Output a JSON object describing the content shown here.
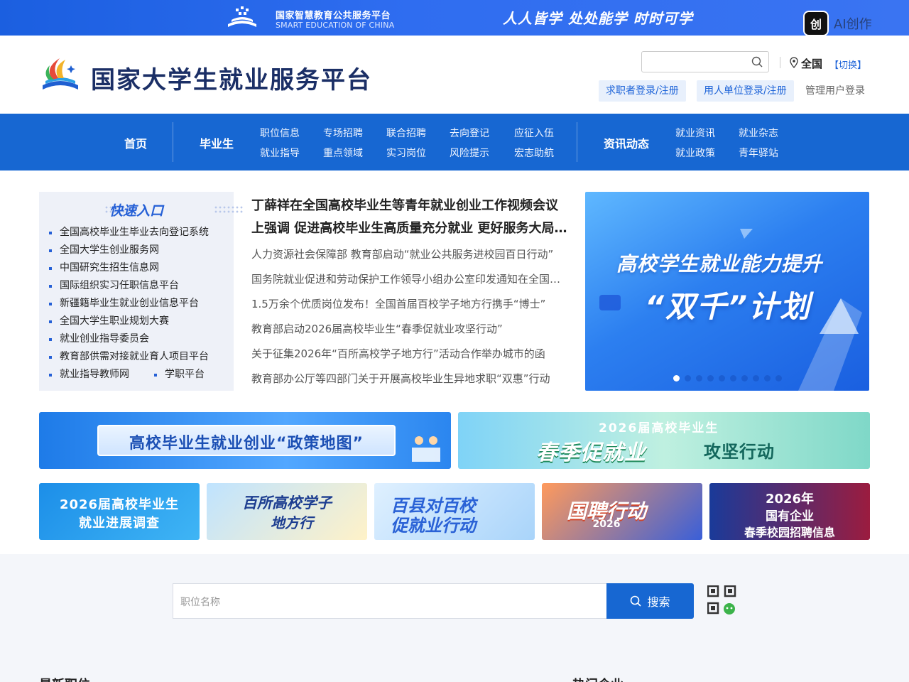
{
  "topbar": {
    "platform_name": "国家智慧教育公共服务平台",
    "platform_sub": "SMART EDUCATION OF CHINA",
    "slogan": "人人皆学 处处能学 时时可学",
    "ai_badge": "创",
    "ai_text": "AI创作"
  },
  "header": {
    "title": "国家大学生就业服务平台",
    "search_placeholder": "",
    "location": "全国",
    "switch_label": "【切换】",
    "seeker_login": "求职者登录/注册",
    "employer_login": "用人单位登录/注册",
    "admin_login": "管理用户登录"
  },
  "nav": {
    "home": "首页",
    "graduates": "毕业生",
    "grad_links": [
      "职位信息",
      "专场招聘",
      "联合招聘",
      "去向登记",
      "应征入伍",
      "就业指导",
      "重点领域",
      "实习岗位",
      "风险提示",
      "宏志助航"
    ],
    "news": "资讯动态",
    "news_links": [
      "就业资讯",
      "就业杂志",
      "就业政策",
      "青年驿站"
    ]
  },
  "quick_entry": {
    "title": "快速入口",
    "items": [
      "全国高校毕业生毕业去向登记系统",
      "全国大学生创业服务网",
      "中国研究生招生信息网",
      "国际组织实习任职信息平台",
      "新疆籍毕业生就业创业信息平台",
      "全国大学生职业规划大赛",
      "就业创业指导委员会",
      "教育部供需对接就业育人项目平台"
    ],
    "last_row": [
      "就业指导教师网",
      "学职平台"
    ]
  },
  "news": {
    "headline_line1": "丁薛祥在全国高校毕业生等青年就业创业工作视频会议",
    "headline_line2": "上强调 促进高校毕业生高质量充分就业 更好服务大局...",
    "items": [
      "人力资源社会保障部 教育部启动“就业公共服务进校园百日行动”",
      "国务院就业促进和劳动保护工作领导小组办公室印发通知在全国开展",
      "1.5万余个优质岗位发布！全国首届百校学子地方行携手“博士”",
      "教育部启动2026届高校毕业生“春季促就业攻坚行动”",
      "关于征集2026年“百所高校学子地方行”活动合作举办城市的函",
      "教育部办公厅等四部门关于开展高校毕业生异地求职“双惠”行动"
    ]
  },
  "carousel": {
    "line1": "高校学生就业能力提升",
    "line2": "“双千”计划",
    "dot_count": 10,
    "active_dot": 0
  },
  "banners": {
    "policy_map": "高校毕业生就业创业“政策地图”",
    "spring_top": "2026届高校毕业生",
    "spring_main": "春季促就业",
    "spring_tail": "攻坚行动",
    "survey_l1": "2026届高校毕业生",
    "survey_l2": "就业进展调查",
    "hundred_l1": "百所高校学子",
    "hundred_l2": "地方行",
    "county_l1": "百县对百校",
    "county_l2": "促就业行动",
    "guopin_l1": "国聘行动",
    "guopin_l2": "2026",
    "soe_l1": "2026年",
    "soe_l2": "国有企业",
    "soe_l3": "春季校园招聘信息"
  },
  "job_search": {
    "placeholder": "职位名称",
    "button": "搜索"
  },
  "sections": {
    "latest_jobs": "最新职位",
    "hot_companies": "热门企业"
  }
}
